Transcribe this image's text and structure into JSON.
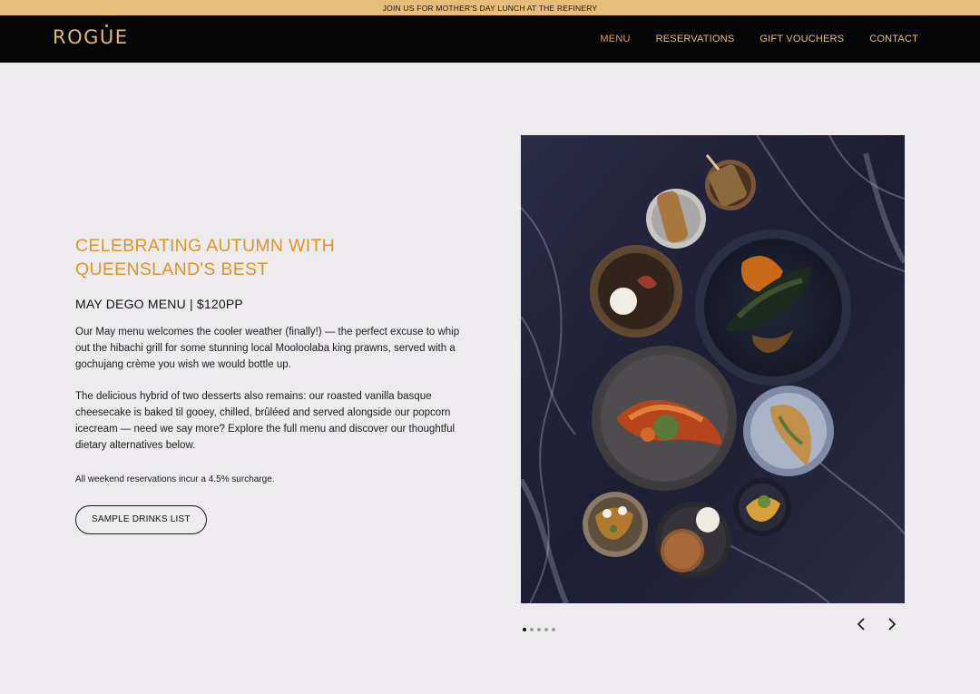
{
  "announcement": "JOIN US FOR MOTHER'S DAY LUNCH AT THE REFINERY",
  "brand": {
    "logo": "ROGUE",
    "colors": {
      "gold": "#e6b86a",
      "accent": "#d8962e",
      "announce_bg": "#e8bd78",
      "nav_bg": "#050505",
      "page_bg": "#edebee"
    }
  },
  "nav": [
    {
      "label": "MENU",
      "active": true
    },
    {
      "label": "RESERVATIONS",
      "active": false
    },
    {
      "label": "GIFT VOUCHERS",
      "active": false
    },
    {
      "label": "CONTACT",
      "active": false
    }
  ],
  "main": {
    "headline_line1": "CELEBRATING AUTUMN WITH",
    "headline_line2": "QUEENSLAND'S BEST",
    "subheading": "MAY DEGO MENU | $120PP",
    "paragraph1": "Our May menu welcomes the cooler weather (finally!) — the perfect excuse to whip out the hibachi grill for some stunning local Mooloolaba king prawns, served with a gochujang crème you wish we would bottle up.",
    "paragraph2": "The delicious hybrid of two desserts also remains: our roasted vanilla basque cheesecake is baked til gooey, chilled, brûléed and served alongside our popcorn icecream — need we say more? Explore the full menu and discover our thoughtful dietary alternatives below.",
    "note": "All weekend reservations incur a 4.5% surcharge.",
    "button": "SAMPLE DRINKS LIST"
  },
  "carousel": {
    "slide_count": 5,
    "current_slide": 1,
    "prev_icon": "chevron-left-icon",
    "next_icon": "chevron-right-icon"
  }
}
